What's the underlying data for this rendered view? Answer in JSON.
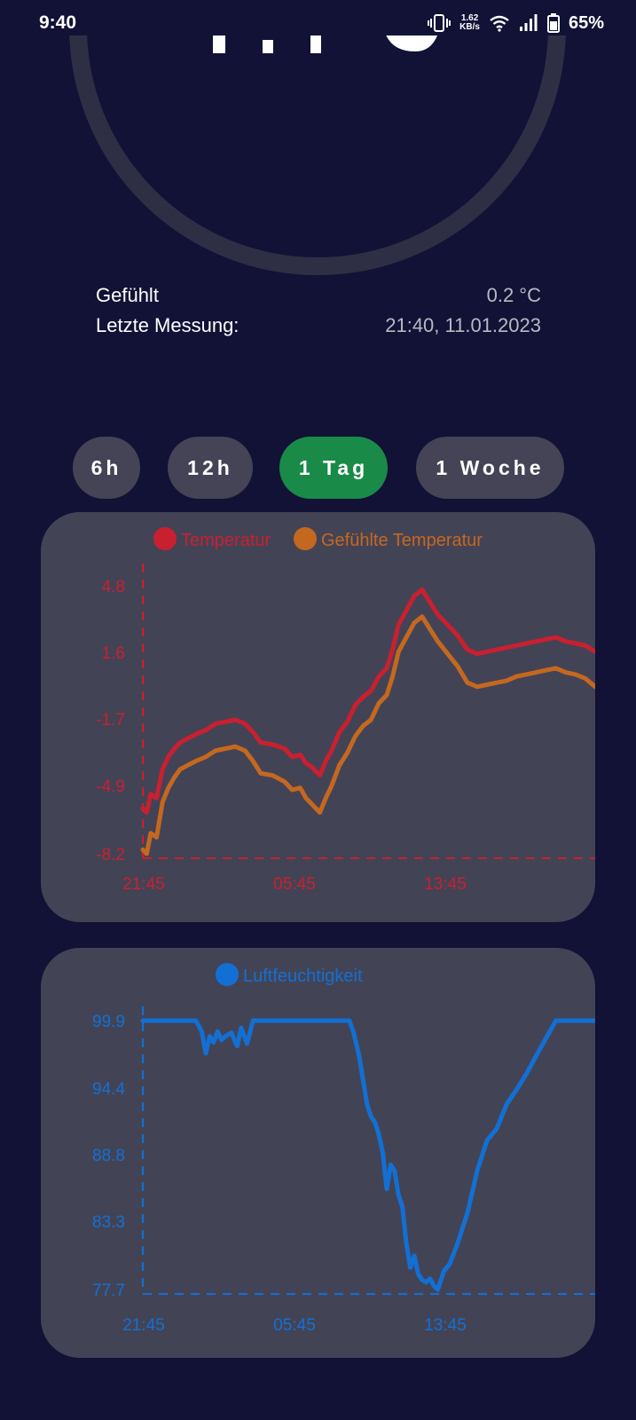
{
  "status_bar": {
    "time": "9:40",
    "net_speed_value": "1.62",
    "net_speed_unit": "KB/s",
    "battery_percent": "65%"
  },
  "info": {
    "felt_label": "Gefühlt",
    "felt_value": "0.2 °C",
    "last_measure_label": "Letzte Messung:",
    "last_measure_value": "21:40, 11.01.2023"
  },
  "range_buttons": [
    {
      "label": "6h",
      "active": false
    },
    {
      "label": "12h",
      "active": false
    },
    {
      "label": "1 Tag",
      "active": true
    },
    {
      "label": "1 Woche",
      "active": false
    }
  ],
  "colors": {
    "temperature": "#c9202f",
    "felt_temperature": "#c5681f",
    "humidity": "#1270d4",
    "active_button": "#1a8a49"
  },
  "chart_data": [
    {
      "type": "line",
      "legend_placement": "top-center",
      "x_ticks": [
        "21:45",
        "05:45",
        "13:45"
      ],
      "y_ticks": [
        "4.8",
        "1.6",
        "-1.7",
        "-4.9",
        "-8.2"
      ],
      "ylim": [
        -8.2,
        5.5
      ],
      "xlim": [
        0,
        23
      ],
      "series": [
        {
          "name": "Temperatur",
          "color": "#c9202f",
          "x": [
            0,
            0.2,
            0.4,
            0.7,
            1,
            1.3,
            1.6,
            1.9,
            2.3,
            2.7,
            3.2,
            3.7,
            4.2,
            4.7,
            5.2,
            5.6,
            6,
            6.6,
            7.2,
            7.6,
            8,
            8.3,
            8.6,
            9,
            9.3,
            9.6,
            10,
            10.4,
            10.8,
            11.2,
            11.6,
            12,
            12.4,
            12.7,
            13,
            13.4,
            13.8,
            14.2,
            14.6,
            15,
            15.5,
            16,
            16.5,
            17,
            17.5,
            18,
            18.5,
            19,
            19.5,
            20,
            20.5,
            21,
            21.5,
            22,
            22.5,
            23
          ],
          "y": [
            -6.0,
            -6.2,
            -5.3,
            -5.5,
            -4.1,
            -3.5,
            -3.1,
            -2.8,
            -2.6,
            -2.4,
            -2.2,
            -1.9,
            -1.8,
            -1.7,
            -1.9,
            -2.3,
            -2.8,
            -2.9,
            -3.1,
            -3.5,
            -3.4,
            -3.8,
            -4.0,
            -4.4,
            -3.7,
            -3.2,
            -2.3,
            -1.8,
            -1.0,
            -0.6,
            -0.3,
            0.4,
            0.8,
            1.7,
            2.9,
            3.6,
            4.3,
            4.6,
            4.0,
            3.4,
            2.9,
            2.4,
            1.7,
            1.5,
            1.6,
            1.7,
            1.8,
            1.9,
            2.0,
            2.1,
            2.2,
            2.3,
            2.1,
            2.0,
            1.9,
            1.6
          ]
        },
        {
          "name": "Gefühlte Temperatur",
          "color": "#c5681f",
          "x": [
            0,
            0.2,
            0.4,
            0.7,
            1,
            1.3,
            1.6,
            1.9,
            2.3,
            2.7,
            3.2,
            3.7,
            4.2,
            4.7,
            5.2,
            5.6,
            6,
            6.6,
            7.2,
            7.6,
            8,
            8.3,
            8.6,
            9,
            9.3,
            9.6,
            10,
            10.4,
            10.8,
            11.2,
            11.6,
            12,
            12.4,
            12.7,
            13,
            13.4,
            13.8,
            14.2,
            14.6,
            15,
            15.5,
            16,
            16.5,
            17,
            17.5,
            18,
            18.5,
            19,
            19.5,
            20,
            20.5,
            21,
            21.5,
            22,
            22.5,
            23
          ],
          "y": [
            -8.0,
            -8.2,
            -7.2,
            -7.4,
            -5.7,
            -5.0,
            -4.5,
            -4.1,
            -3.9,
            -3.7,
            -3.5,
            -3.2,
            -3.1,
            -3.0,
            -3.2,
            -3.7,
            -4.3,
            -4.4,
            -4.7,
            -5.1,
            -5.0,
            -5.5,
            -5.8,
            -6.2,
            -5.5,
            -4.9,
            -3.9,
            -3.3,
            -2.5,
            -2.0,
            -1.7,
            -0.9,
            -0.5,
            0.4,
            1.6,
            2.3,
            3.0,
            3.3,
            2.7,
            2.1,
            1.5,
            0.9,
            0.1,
            -0.1,
            0.0,
            0.1,
            0.2,
            0.4,
            0.5,
            0.6,
            0.7,
            0.8,
            0.6,
            0.5,
            0.3,
            -0.1
          ]
        }
      ]
    },
    {
      "type": "line",
      "legend_placement": "top-center",
      "x_ticks": [
        "21:45",
        "05:45",
        "13:45"
      ],
      "y_ticks": [
        "99.9",
        "94.4",
        "88.8",
        "83.3",
        "77.7"
      ],
      "ylim": [
        77.7,
        99.9
      ],
      "xlim": [
        0,
        23
      ],
      "series": [
        {
          "name": "Luftfeuchtigkeit",
          "color": "#1270d4",
          "x": [
            0,
            1,
            2,
            2.7,
            3.0,
            3.2,
            3.4,
            3.6,
            3.8,
            4.0,
            4.2,
            4.5,
            4.8,
            5.0,
            5.3,
            5.6,
            6,
            7,
            8,
            9,
            10,
            10.5,
            10.7,
            11,
            11.2,
            11.4,
            11.6,
            11.8,
            12.0,
            12.2,
            12.4,
            12.6,
            12.8,
            13.0,
            13.2,
            13.4,
            13.6,
            13.8,
            14.0,
            14.2,
            14.4,
            14.6,
            14.8,
            15.0,
            15.3,
            15.6,
            16,
            16.5,
            17,
            17.5,
            18,
            18.5,
            19,
            19.5,
            20,
            21,
            22,
            23
          ],
          "y": [
            99.9,
            99.9,
            99.9,
            99.9,
            99.0,
            97.2,
            98.6,
            98.1,
            99.0,
            98.3,
            98.6,
            98.9,
            97.8,
            99.3,
            98.0,
            99.9,
            99.9,
            99.9,
            99.9,
            99.9,
            99.9,
            99.9,
            99.0,
            97.0,
            95.0,
            93.0,
            92.0,
            91.5,
            90.5,
            89.0,
            86.0,
            88.0,
            87.5,
            85.5,
            84.5,
            81.5,
            79.5,
            80.5,
            79.0,
            78.5,
            78.3,
            78.6,
            78.0,
            77.7,
            79.2,
            79.8,
            81.5,
            84.0,
            87.5,
            90.0,
            91.0,
            93.0,
            94.2,
            95.5,
            97.0,
            99.9,
            99.9,
            99.9
          ]
        }
      ]
    }
  ]
}
